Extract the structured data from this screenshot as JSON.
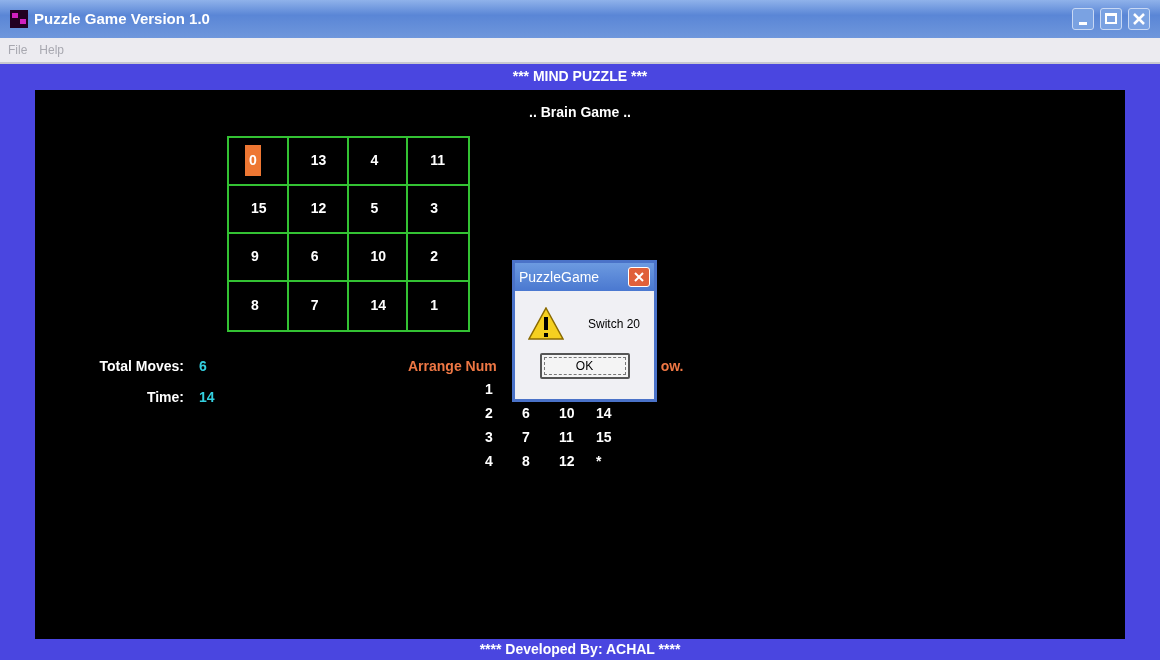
{
  "window": {
    "title": "Puzzle Game Version 1.0"
  },
  "menu": [
    {
      "label": "File",
      "disabled": true
    },
    {
      "label": "Help",
      "disabled": true
    }
  ],
  "header": "*** MIND PUZZLE ***",
  "subtitle": ".. Brain Game ..",
  "board": [
    [
      {
        "text": "0",
        "selected": true
      },
      {
        "text": "13",
        "selected": false
      },
      {
        "text": "4",
        "selected": false
      },
      {
        "text": "11",
        "selected": false
      }
    ],
    [
      {
        "text": "15",
        "selected": false
      },
      {
        "text": "12",
        "selected": false
      },
      {
        "text": "5",
        "selected": false
      },
      {
        "text": "3",
        "selected": false
      }
    ],
    [
      {
        "text": "9",
        "selected": false
      },
      {
        "text": "6",
        "selected": false
      },
      {
        "text": "10",
        "selected": false
      },
      {
        "text": "2",
        "selected": false
      }
    ],
    [
      {
        "text": "8",
        "selected": false
      },
      {
        "text": "7",
        "selected": false
      },
      {
        "text": "14",
        "selected": false
      },
      {
        "text": "1",
        "selected": false
      }
    ]
  ],
  "stats": [
    {
      "label": "Total Moves:",
      "value": "6"
    },
    {
      "label": "Time:",
      "value": "14"
    }
  ],
  "hint": {
    "before": "Arrange Num",
    "after": "ow."
  },
  "order": [
    [
      "1"
    ],
    [
      "2",
      "6",
      "10",
      "14"
    ],
    [
      "3",
      "7",
      "11",
      "15"
    ],
    [
      "4",
      "8",
      "12",
      "*"
    ]
  ],
  "dialog": {
    "title": "PuzzleGame",
    "message": "Switch 20",
    "button": "OK"
  },
  "footer": "**** Developed By: ACHAL ****"
}
